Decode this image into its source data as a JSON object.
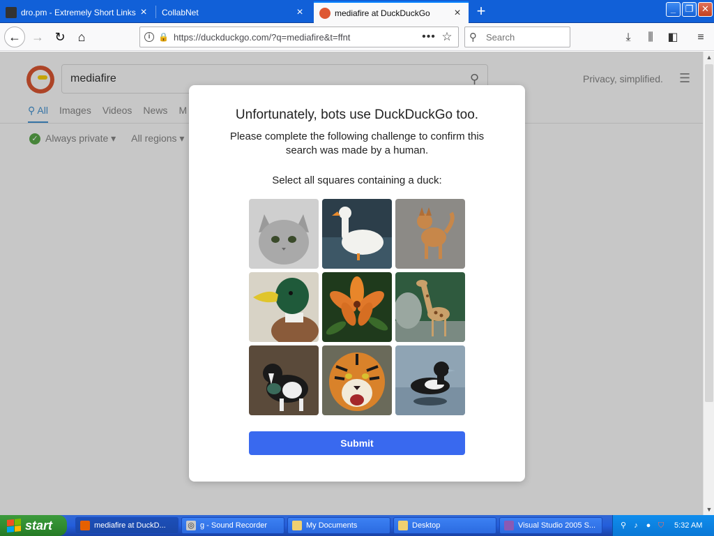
{
  "tabs": [
    {
      "title": "dro.pm - Extremely Short Links",
      "active": false
    },
    {
      "title": "CollabNet",
      "active": false
    },
    {
      "title": "mediafire at DuckDuckGo",
      "active": true
    }
  ],
  "navbar": {
    "url": "https://duckduckgo.com/?q=mediafire&t=ffnt",
    "search_placeholder": "Search"
  },
  "ddg": {
    "query": "mediafire",
    "privacy": "Privacy, simplified.",
    "tabs": [
      "All",
      "Images",
      "Videos",
      "News",
      "M"
    ],
    "filters": [
      "Always private ▾",
      "All regions ▾"
    ]
  },
  "modal": {
    "title": "Unfortunately, bots use DuckDuckGo too.",
    "subtitle": "Please complete the following challenge to confirm this search was made by a human.",
    "prompt": "Select all squares containing a duck:",
    "submit": "Submit",
    "images": [
      "cat",
      "white-duck",
      "dog",
      "mallard-duck",
      "lily-flower",
      "giraffe",
      "border-collie",
      "tiger",
      "black-duck"
    ]
  },
  "taskbar": {
    "start": "start",
    "tasks": [
      {
        "label": "mediafire at DuckD...",
        "active": true
      },
      {
        "label": "g - Sound Recorder",
        "active": false
      },
      {
        "label": "My Documents",
        "active": false
      },
      {
        "label": "Desktop",
        "active": false
      },
      {
        "label": "Visual Studio 2005 S...",
        "active": false
      }
    ],
    "clock": "5:32 AM"
  },
  "colors": {
    "accent": "#3969ef",
    "titlebar": "#1160d8",
    "ddg_brand": "#de5833"
  }
}
